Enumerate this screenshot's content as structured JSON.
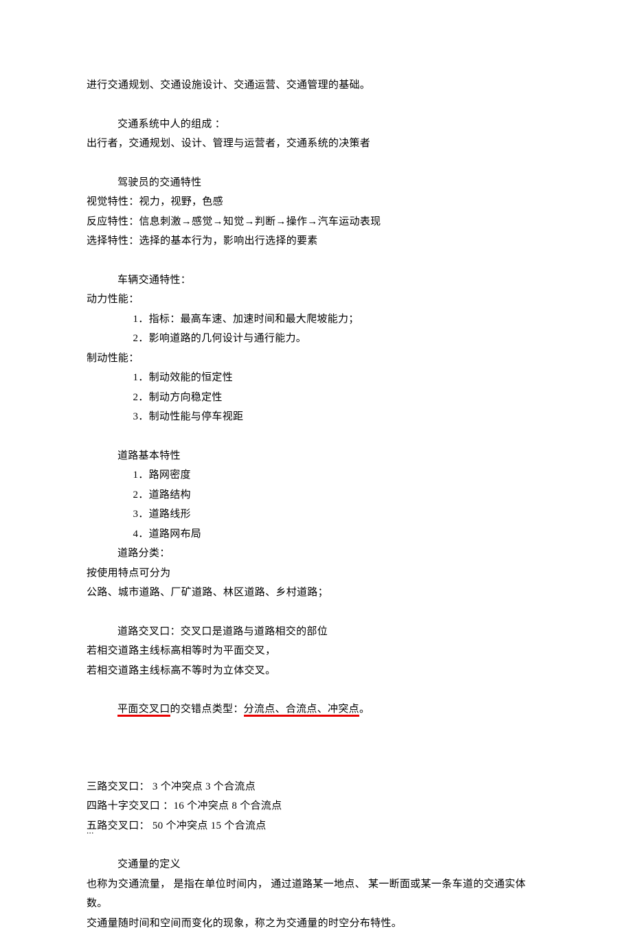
{
  "p1": "进行交通规划、交通设施设计、交通运营、交通管理的基础。",
  "p2": "交通系统中人的组成  ：",
  "p3": "出行者，交通规划、设计、管理与运营者，交通系统的决策者",
  "p4": "驾驶员的交通特性",
  "p5": "视觉特性：视力，视野，色感",
  "p6": "反应特性：信息刺激→感觉→知觉→判断→操作→汽车运动表现",
  "p7": "选择特性：选择的基本行为，影响出行选择的要素",
  "p8": "车辆交通特性：",
  "p9": "动力性能：",
  "p10": "1．指标：最高车速、加速时间和最大爬坡能力；",
  "p11": "2．影响道路的几何设计与通行能力。",
  "p12": "制动性能：",
  "p13": "1．制动效能的恒定性",
  "p14": "2．制动方向稳定性",
  "p15": "3．制动性能与停车视距",
  "p16": "道路基本特性",
  "p17": "1．路网密度",
  "p18": "2．道路结构",
  "p19": "3．道路线形",
  "p20": "4．道路网布局",
  "p21": "道路分类：",
  "p22": "按使用特点可分为",
  "p23": "公路、城市道路、厂矿道路、林区道路、乡村道路；",
  "p24": "道路交叉口：交叉口是道路与道路相交的部位",
  "p25": "若相交道路主线标高相等时为平面交叉，",
  "p26": "若相交道路主线标高不等时为立体交叉。",
  "p27a": "平面交叉口",
  "p27b": "的交错点类型：",
  "p27c": "分流点、合流点、冲突点",
  "p27d": "。",
  "p28": "三路交叉口：   3 个冲突点 3 个合流点",
  "p29": "四路十字交叉口    ：16 个冲突点 8  个合流点",
  "p30": "五路交叉口：  50 个冲突点   15 个合流点",
  "p31": "交通量的定义",
  "p32": "也称为交通流量， 是指在单位时间内， 通过道路某一地点、 某一断面或某一条车道的交通实体数。",
  "p33": "交通量随时间和空间而变化的现象，称之为交通量的时空分布特性。",
  "footer": "..."
}
